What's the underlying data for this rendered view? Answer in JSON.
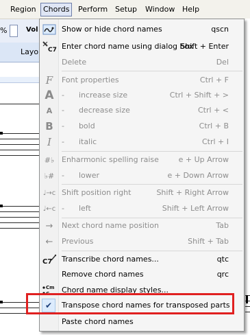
{
  "menubar": {
    "items": [
      "Region",
      "Chords",
      "Perform",
      "Setup",
      "Window",
      "Help"
    ],
    "active": "Chords"
  },
  "toolbar": {
    "percent": "%",
    "vol_label": "Vol",
    "layout_label": "Layou"
  },
  "menu": {
    "items": [
      {
        "label": "Show or hide chord names",
        "shortcut": "qscn",
        "icon": "chord-names-toggle-icon",
        "enabled": true
      },
      {
        "label": "Enter chord name using dialog box",
        "shortcut": "Shift + Enter",
        "icon": "chord-c7-dialog-icon",
        "enabled": true
      },
      {
        "label": "Delete",
        "shortcut": "Del",
        "icon": "",
        "enabled": false
      },
      {
        "label": "Font properties",
        "shortcut": "Ctrl + F",
        "icon": "font-f-icon",
        "enabled": false
      },
      {
        "label": "-      increase size",
        "shortcut": "Ctrl + Shift + >",
        "icon": "font-increase-icon",
        "enabled": false
      },
      {
        "label": "-      decrease size",
        "shortcut": "Ctrl + <",
        "icon": "font-decrease-icon",
        "enabled": false
      },
      {
        "label": "-      bold",
        "shortcut": "Ctrl + B",
        "icon": "bold-icon",
        "enabled": false
      },
      {
        "label": "-      italic",
        "shortcut": "Ctrl + I",
        "icon": "italic-icon",
        "enabled": false
      },
      {
        "label": "Enharmonic spelling raise",
        "shortcut": "e + Up Arrow",
        "icon": "enharmonic-raise-icon",
        "enabled": false
      },
      {
        "label": "-      lower",
        "shortcut": "e + Down Arrow",
        "icon": "enharmonic-lower-icon",
        "enabled": false
      },
      {
        "label": "Shift position right",
        "shortcut": "Shift + Right Arrow",
        "icon": "shift-right-icon",
        "enabled": false
      },
      {
        "label": "-      left",
        "shortcut": "Shift + Left Arrow",
        "icon": "shift-left-icon",
        "enabled": false
      },
      {
        "label": "Next chord name position",
        "shortcut": "Tab",
        "icon": "next-arrow-icon",
        "enabled": false
      },
      {
        "label": "Previous",
        "shortcut": "Shift + Tab",
        "icon": "previous-arrow-icon",
        "enabled": false
      },
      {
        "label": "Transcribe chord names...",
        "shortcut": "qtc",
        "icon": "transcribe-c7-icon",
        "enabled": true
      },
      {
        "label": "Remove chord names",
        "shortcut": "qrc",
        "icon": "",
        "enabled": true
      },
      {
        "label": "Chord name display styles...",
        "shortcut": "",
        "icon": "chord-display-styles-icon",
        "enabled": true
      },
      {
        "label": "Transpose chord names for transposed parts",
        "shortcut": "",
        "icon": "checkmark-icon",
        "enabled": true,
        "checked": true
      },
      {
        "label": "Paste chord names",
        "shortcut": "",
        "icon": "",
        "enabled": true
      }
    ]
  },
  "colors": {
    "highlight_border": "#e02020",
    "disabled_text": "#8d8d8d"
  }
}
